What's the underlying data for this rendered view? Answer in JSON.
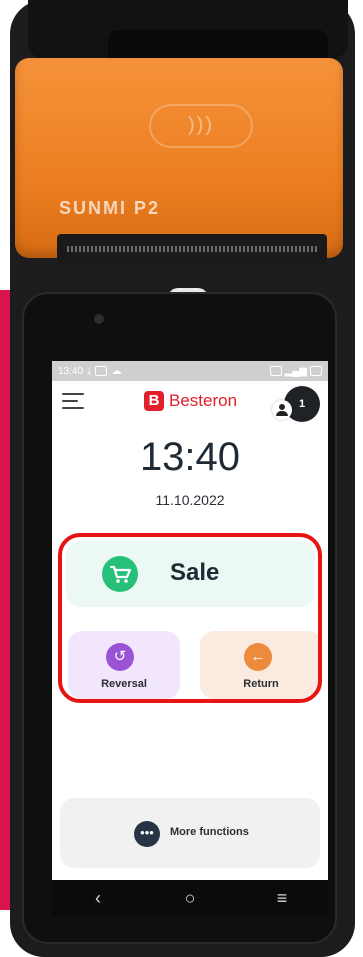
{
  "device": {
    "brand": "SUNMI P2",
    "nfc_symbol": "))) "
  },
  "status_bar": {
    "time": "13:40"
  },
  "app": {
    "logo_mark": "B",
    "logo_text": "Besteron",
    "user_badge": "1"
  },
  "home": {
    "time": "13:40",
    "date": "11.10.2022"
  },
  "actions": {
    "sale": {
      "label": "Sale",
      "icon": "shopping-cart-icon"
    },
    "reversal": {
      "label": "Reversal",
      "icon": "undo-icon",
      "symbol": "↺"
    },
    "return": {
      "label": "Return",
      "icon": "arrow-left-icon",
      "symbol": "←"
    },
    "more": {
      "label": "More functions",
      "icon": "more-dots-icon",
      "symbol": "•••"
    }
  },
  "nav": {
    "back": "‹",
    "home": "○",
    "menu": "≡"
  },
  "colors": {
    "brand_red": "#e2202c",
    "sale_green": "#27c07b",
    "reversal_purple": "#9b53d6",
    "return_orange": "#ee8a3b",
    "highlight_red": "#e81414"
  }
}
